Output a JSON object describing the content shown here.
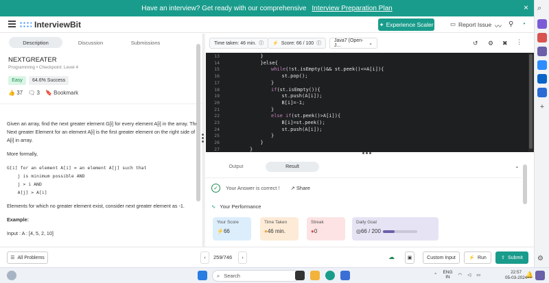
{
  "banner": {
    "text": "Have an interview? Get ready with our comprehensive",
    "link": "Interview Preparation Plan",
    "close": "×"
  },
  "header": {
    "logo": "InterviewBit",
    "experience_button": "Experience Scaler",
    "report_issue": "Report Issue"
  },
  "left_tabs": [
    "Description",
    "Discussion",
    "Submissions"
  ],
  "problem": {
    "title": "NEXTGREATER",
    "subtitle": "Programming • Checkpoint: Level 4",
    "difficulty": "Easy",
    "success": "64.6% Success",
    "likes": "37",
    "comments": "3",
    "bookmark": "Bookmark"
  },
  "description": {
    "p1": "Given an array, find the next greater element G[i] for every element A[i] in the array.  The Next greater Element for an element A[i] is the first greater element on the right side of A[i] in array.",
    "p2": "More formally,",
    "code": "G[i] for an element A[i] = an element A[j] such that\n    j is minimum possible AND\n    j > i AND\n    A[j] > A[i]",
    "p3": "Elements for which no greater element exist, consider next greater element as -1.",
    "example_label": "Example:",
    "input": "Input : A : [4, 5, 2, 10]"
  },
  "editor_toolbar": {
    "time_taken": "Time taken: 46 min.",
    "score": "Score:  66  /  100",
    "language": "Java7 (Open-J..."
  },
  "code_lines": [
    {
      "n": "13",
      "indent": 3,
      "text": "}"
    },
    {
      "n": "14",
      "indent": 3,
      "text": "}else{"
    },
    {
      "n": "15",
      "indent": 4,
      "kw": "while",
      "text": "(!st.isEmpty()&& st.peek()<=A[i]){"
    },
    {
      "n": "16",
      "indent": 5,
      "text": "st.pop();"
    },
    {
      "n": "17",
      "indent": 4,
      "text": "}"
    },
    {
      "n": "18",
      "indent": 4,
      "kw": "if",
      "text": "(st.isEmpty()){"
    },
    {
      "n": "19",
      "indent": 5,
      "text": "st.push(A[i]);"
    },
    {
      "n": "20",
      "indent": 5,
      "text": "B[i]=-1;"
    },
    {
      "n": "21",
      "indent": 4,
      "text": "}"
    },
    {
      "n": "22",
      "indent": 4,
      "kw": "else if",
      "text": "(st.peek()>A[i]){"
    },
    {
      "n": "23",
      "indent": 5,
      "text": "B[i]=st.peek();"
    },
    {
      "n": "24",
      "indent": 5,
      "text": "st.push(A[i]);"
    },
    {
      "n": "25",
      "indent": 4,
      "text": "}"
    },
    {
      "n": "26",
      "indent": 3,
      "text": "}"
    },
    {
      "n": "27",
      "indent": 2,
      "text": "}"
    }
  ],
  "result_tabs": [
    "Output",
    "Result"
  ],
  "result": {
    "message": "Your Answer is correct !",
    "share": "Share",
    "performance": "Your Performance",
    "cards": [
      {
        "label": "Your Score",
        "value": "66",
        "bg": "#dceefc"
      },
      {
        "label": "Time Taken",
        "value": "46 min.",
        "bg": "#fdebd7"
      },
      {
        "label": "Streak",
        "value": "0",
        "bg": "#fde3e3"
      },
      {
        "label": "Daily Goal",
        "value": "66 / 200",
        "bg": "#e6e3f4"
      }
    ],
    "daily_goal_fraction": 0.33
  },
  "bottom": {
    "all_problems": "All Problems",
    "pager": "259/746",
    "custom_input": "Custom Input",
    "run": "Run",
    "submit": "Submit"
  },
  "taskbar": {
    "search": "Search",
    "lang": "ENG",
    "region": "IN",
    "time": "22:57",
    "date": "05-03-2024"
  },
  "colors": {
    "accent": "#1a9c8c",
    "code_bg": "#1e1f21",
    "keyword": "#c586c0"
  }
}
